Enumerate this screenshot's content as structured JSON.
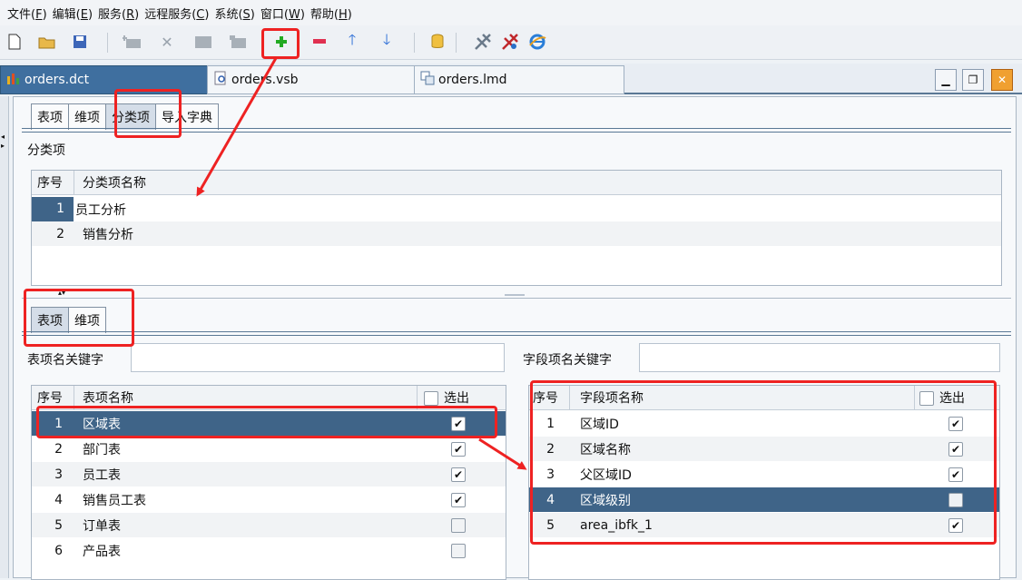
{
  "menu": [
    {
      "label": "文件(",
      "key": "F",
      "end": ")"
    },
    {
      "label": "编辑(",
      "key": "E",
      "end": ")"
    },
    {
      "label": "服务(",
      "key": "R",
      "end": ")"
    },
    {
      "label": "远程服务(",
      "key": "C",
      "end": ")"
    },
    {
      "label": "系统(",
      "key": "S",
      "end": ")"
    },
    {
      "label": "窗口(",
      "key": "W",
      "end": ")"
    },
    {
      "label": "帮助(",
      "key": "H",
      "end": ")"
    }
  ],
  "toolbar": {
    "icons": [
      "new-file-icon",
      "open-folder-icon",
      "save-icon",
      "add-table-icon",
      "delete-icon",
      "table-icon",
      "table-link-icon",
      "add-item-icon",
      "remove-item-icon",
      "move-up-icon",
      "move-down-icon",
      "database-icon",
      "tool-a-icon",
      "tool-b-icon",
      "browser-icon"
    ]
  },
  "doc_tabs": [
    "orders.dct",
    "orders.vsb",
    "orders.lmd"
  ],
  "top_tabs": [
    "表项",
    "维项",
    "分类项",
    "导入字典"
  ],
  "category_section": {
    "title": "分类项",
    "col_seq": "序号",
    "col_name": "分类项名称",
    "rows": [
      {
        "seq": "1",
        "name": "员工分析"
      },
      {
        "seq": "2",
        "name": "销售分析"
      }
    ]
  },
  "bottom_tabs": [
    "表项",
    "维项"
  ],
  "table_section": {
    "keyword_label": "表项名关键字",
    "keyword_value": "",
    "col_seq": "序号",
    "col_name": "表项名称",
    "col_select": "选出",
    "rows": [
      {
        "seq": "1",
        "name": "区域表",
        "checked": true
      },
      {
        "seq": "2",
        "name": "部门表",
        "checked": true
      },
      {
        "seq": "3",
        "name": "员工表",
        "checked": true
      },
      {
        "seq": "4",
        "name": "销售员工表",
        "checked": true
      },
      {
        "seq": "5",
        "name": "订单表",
        "checked": false
      },
      {
        "seq": "6",
        "name": "产品表",
        "checked": false
      }
    ]
  },
  "field_section": {
    "keyword_label": "字段项名关键字",
    "keyword_value": "",
    "col_seq": "序号",
    "col_name": "字段项名称",
    "col_select": "选出",
    "rows": [
      {
        "seq": "1",
        "name": "区域ID",
        "checked": true
      },
      {
        "seq": "2",
        "name": "区域名称",
        "checked": true
      },
      {
        "seq": "3",
        "name": "父区域ID",
        "checked": true
      },
      {
        "seq": "4",
        "name": "区域级别",
        "checked": false
      },
      {
        "seq": "5",
        "name": "area_ibfk_1",
        "checked": true
      }
    ]
  },
  "colors": {
    "selection": "#3f6488",
    "annotation": "#ee2222",
    "accent": "#5a7895"
  }
}
